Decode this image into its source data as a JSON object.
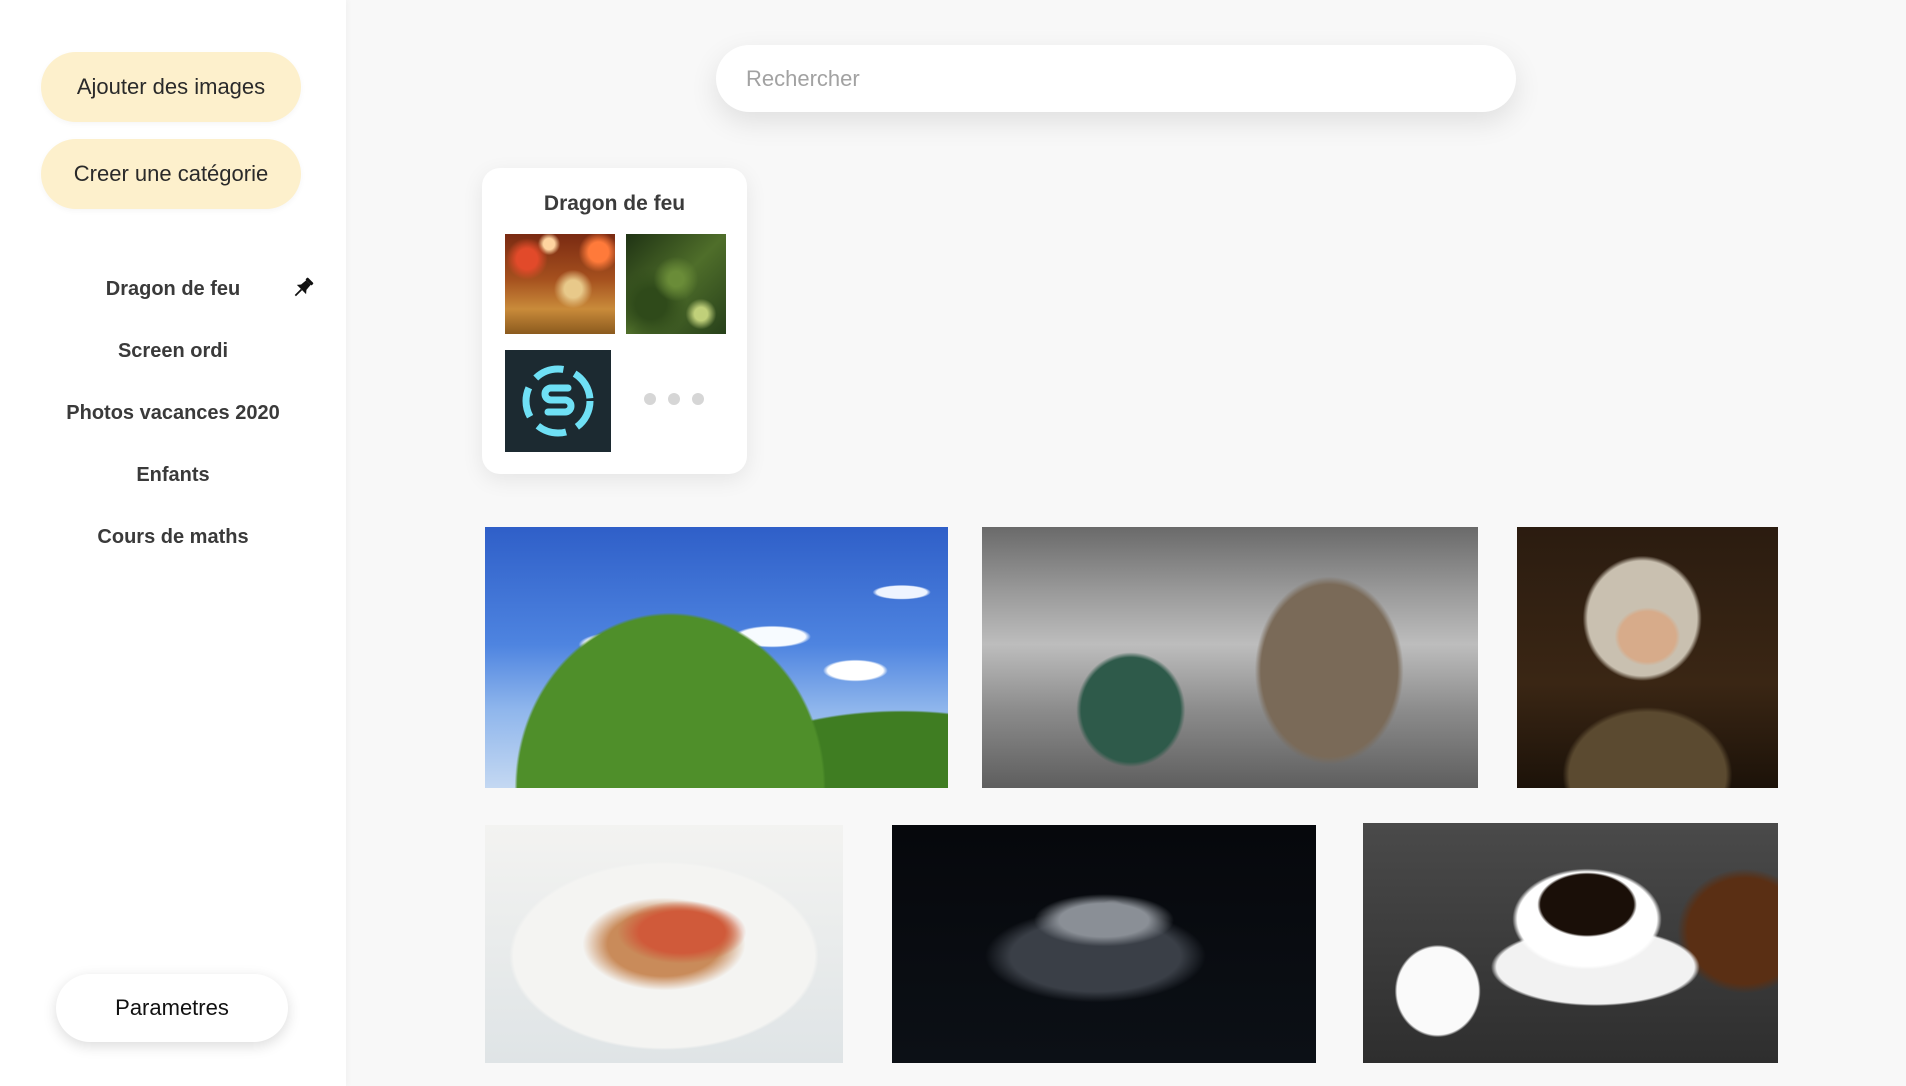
{
  "sidebar": {
    "add_images_label": "Ajouter des images",
    "create_category_label": "Creer une catégorie",
    "categories": [
      {
        "label": "Dragon de feu",
        "pinned": true
      },
      {
        "label": "Screen ordi",
        "pinned": false
      },
      {
        "label": "Photos vacances 2020",
        "pinned": false
      },
      {
        "label": "Enfants",
        "pinned": false
      },
      {
        "label": "Cours de maths",
        "pinned": false
      }
    ],
    "settings_label": "Parametres",
    "pin_icon": "pin-icon",
    "accent_color": "#fdf0cc"
  },
  "search": {
    "placeholder": "Rechercher",
    "value": ""
  },
  "category_card": {
    "title": "Dragon de feu",
    "thumbnails": [
      "golden-ornaments-thumbnail",
      "green-foliage-thumbnail",
      "blue-ring-logo-thumbnail"
    ],
    "more_icon": "more-dots-icon"
  },
  "gallery": {
    "photos": [
      {
        "name": "bliss-hill-photo"
      },
      {
        "name": "elephant-woman-photo"
      },
      {
        "name": "portrait-painting-photo"
      },
      {
        "name": "salad-plate-photo"
      },
      {
        "name": "spaceship-photo"
      },
      {
        "name": "coffee-cup-photo"
      }
    ]
  }
}
